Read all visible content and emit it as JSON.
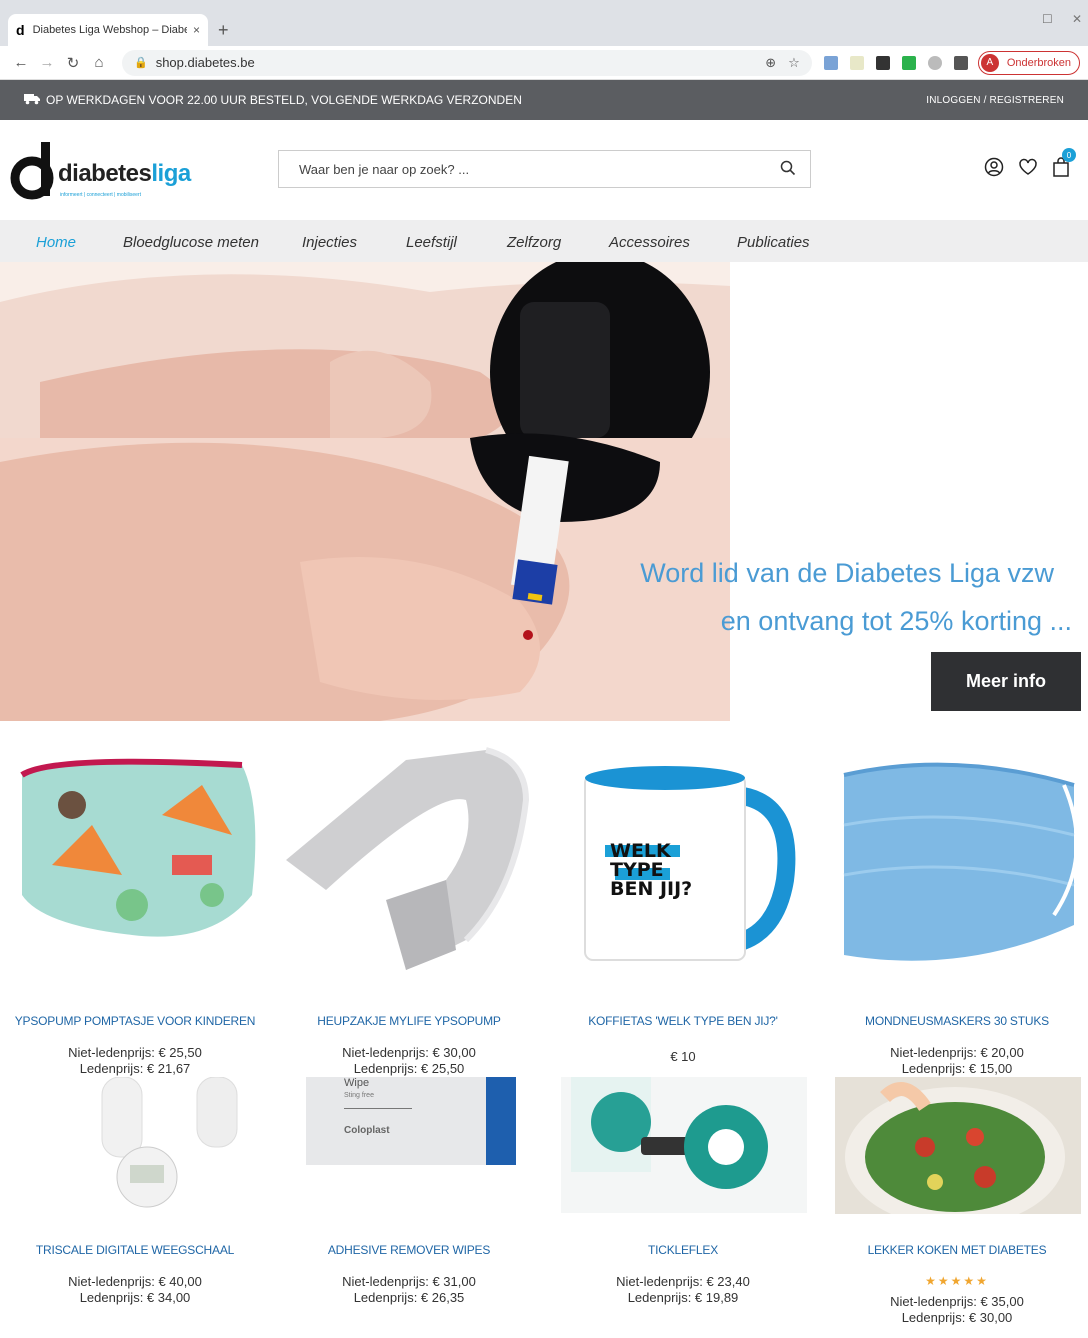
{
  "browser": {
    "tab_title": "Diabetes Liga Webshop – Diabet",
    "tab_favicon": "d",
    "tab_close": "×",
    "new_tab": "+",
    "url": "shop.diabetes.be",
    "profile_initial": "A",
    "profile_label": "Onderbroken"
  },
  "topbar": {
    "shipping": "OP WERKDAGEN VOOR 22.00 UUR BESTELD, VOLGENDE WERKDAG VERZONDEN",
    "login": "INLOGGEN / REGISTREREN"
  },
  "header": {
    "logo_text_dark": "diabetes",
    "logo_text_blue": "liga",
    "logo_tagline": "informeert | connecteert | mobiliseert",
    "search_placeholder": "Waar ben je naar op zoek?  ...",
    "cart_count": "0"
  },
  "nav": {
    "items": [
      {
        "label": "Home",
        "active": true
      },
      {
        "label": "Bloedglucose meten"
      },
      {
        "label": "Injecties"
      },
      {
        "label": "Leefstijl"
      },
      {
        "label": "Zelfzorg"
      },
      {
        "label": "Accessoires"
      },
      {
        "label": "Publicaties"
      }
    ]
  },
  "hero": {
    "line1": "Word lid van de Diabetes Liga vzw",
    "line2": "en ontvang tot 25% korting ...",
    "button": "Meer info"
  },
  "products": [
    {
      "name": "YPSOPUMP POMPTASJE VOOR KINDEREN",
      "price1": "Niet-ledenprijs: € 25,50",
      "price2": "Ledenprijs: € 21,67"
    },
    {
      "name": "HEUPZAKJE MYLIFE YPSOPUMP",
      "price1": "Niet-ledenprijs: € 30,00",
      "price2": "Ledenprijs: € 25,50"
    },
    {
      "name": "KOFFIETAS 'WELK TYPE BEN JIJ?'",
      "price1": "€ 10",
      "price2": ""
    },
    {
      "name": "MONDNEUSMASKERS 30 STUKS",
      "price1": "Niet-ledenprijs: € 20,00",
      "price2": "Ledenprijs: € 15,00"
    },
    {
      "name": "TRISCALE DIGITALE WEEGSCHAAL",
      "price1": "Niet-ledenprijs: € 40,00",
      "price2": "Ledenprijs: € 34,00"
    },
    {
      "name": "ADHESIVE REMOVER WIPES",
      "price1": "Niet-ledenprijs: € 31,00",
      "price2": "Ledenprijs: € 26,35"
    },
    {
      "name": "TICKLEFLEX",
      "price1": "Niet-ledenprijs: € 23,40",
      "price2": "Ledenprijs: € 19,89"
    },
    {
      "name": "LEKKER KOKEN MET DIABETES",
      "rating": "★★★★★",
      "price1": "Niet-ledenprijs: € 35,00",
      "price2": "Ledenprijs: € 30,00"
    }
  ],
  "product_image_text": {
    "mug_line1": "WELK",
    "mug_line2": "TYPE",
    "mug_line3": "BEN JIJ?",
    "wipes_line1": "Wipe",
    "wipes_line2": "Sting free",
    "wipes_brand": "Coloplast"
  },
  "colors": {
    "accent": "#1ba0d7",
    "topbar": "#5b5d61",
    "nav_bg": "#eeeeef",
    "product_name": "#1f66a6",
    "hero_text": "#4a9bd4",
    "button_dark": "#2f3033"
  }
}
